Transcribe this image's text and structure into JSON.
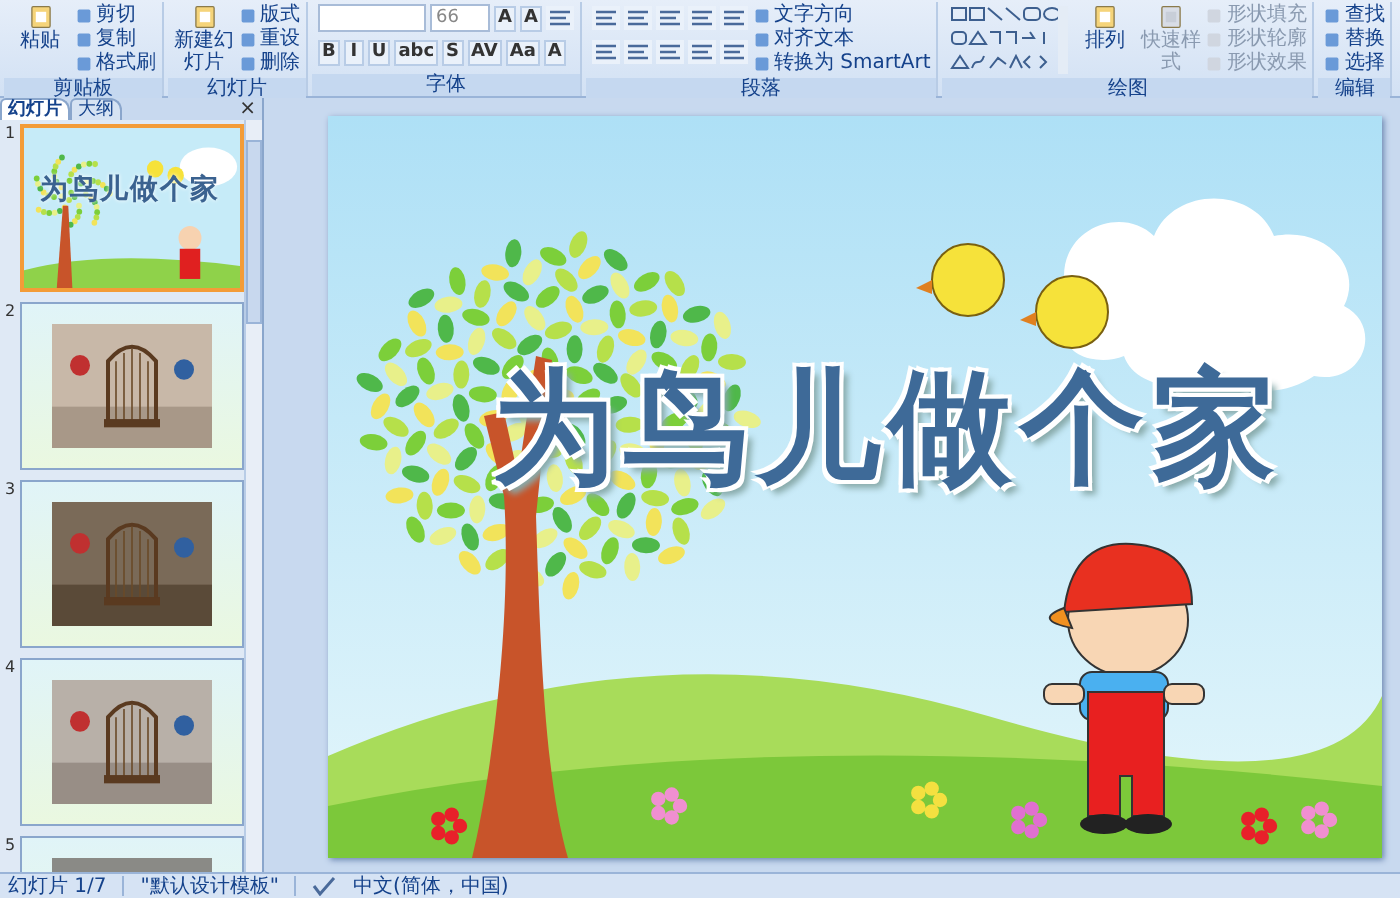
{
  "ribbon": {
    "groups": [
      {
        "label": "剪贴板",
        "items": [
          {
            "kind": "large",
            "label": "粘贴"
          },
          {
            "kind": "small",
            "label": "剪切"
          },
          {
            "kind": "small",
            "label": "复制"
          },
          {
            "kind": "small",
            "label": "格式刷"
          }
        ]
      },
      {
        "label": "幻灯片",
        "items": [
          {
            "kind": "large",
            "label": "新建幻灯片"
          },
          {
            "kind": "small",
            "label": "版式"
          },
          {
            "kind": "small",
            "label": "重设"
          },
          {
            "kind": "small",
            "label": "删除"
          }
        ]
      },
      {
        "label": "字体",
        "rows": [
          {
            "tools": [
              {
                "kind": "field"
              },
              {
                "kind": "field",
                "value": "66"
              },
              {
                "kind": "glyph",
                "label": "A"
              },
              {
                "kind": "glyph",
                "label": "A"
              },
              {
                "kind": "icon"
              }
            ]
          },
          {
            "tools": [
              {
                "kind": "glyph",
                "label": "B"
              },
              {
                "kind": "glyph",
                "label": "I"
              },
              {
                "kind": "glyph",
                "label": "U"
              },
              {
                "kind": "glyph",
                "label": "abc"
              },
              {
                "kind": "glyph",
                "label": "S"
              },
              {
                "kind": "glyph",
                "label": "AV"
              },
              {
                "kind": "glyph",
                "label": "Aa"
              },
              {
                "kind": "glyph",
                "label": "A"
              }
            ]
          }
        ]
      },
      {
        "label": "段落",
        "rows": [
          {
            "tools": [
              {
                "kind": "icon"
              },
              {
                "kind": "icon"
              },
              {
                "kind": "icon"
              },
              {
                "kind": "icon"
              },
              {
                "kind": "icon"
              }
            ]
          },
          {
            "tools": [
              {
                "kind": "icon"
              },
              {
                "kind": "icon"
              },
              {
                "kind": "icon"
              },
              {
                "kind": "icon"
              },
              {
                "kind": "icon"
              }
            ]
          }
        ],
        "items": [
          {
            "kind": "small",
            "label": "文字方向"
          },
          {
            "kind": "small",
            "label": "对齐文本"
          },
          {
            "kind": "small",
            "label": "转换为 SmartArt"
          }
        ]
      },
      {
        "label": "绘图",
        "items": [
          {
            "kind": "gallery",
            "disabled": false
          },
          {
            "kind": "large",
            "label": "排列",
            "disabled": false
          },
          {
            "kind": "large",
            "label": "快速样式",
            "disabled": true
          },
          {
            "kind": "small",
            "label": "形状填充",
            "disabled": true
          },
          {
            "kind": "small",
            "label": "形状轮廓",
            "disabled": true
          },
          {
            "kind": "small",
            "label": "形状效果",
            "disabled": true
          }
        ]
      },
      {
        "label": "编辑",
        "items": [
          {
            "kind": "small",
            "label": "查找"
          },
          {
            "kind": "small",
            "label": "替换"
          },
          {
            "kind": "small",
            "label": "选择"
          }
        ]
      }
    ]
  },
  "panel": {
    "tabs": [
      {
        "label": "幻灯片",
        "selected": true
      },
      {
        "label": "大纲",
        "selected": false
      }
    ],
    "close": "×",
    "slides": [
      {
        "number": "1",
        "selected": true,
        "kind": "title",
        "title": "为鸟儿做个家"
      },
      {
        "number": "2",
        "selected": false,
        "kind": "picture"
      },
      {
        "number": "3",
        "selected": false,
        "kind": "picture"
      },
      {
        "number": "4",
        "selected": false,
        "kind": "picture"
      },
      {
        "number": "5",
        "selected": false,
        "kind": "picture"
      }
    ]
  },
  "slide": {
    "title": "为鸟儿做个家"
  },
  "status_bar": {
    "slide": "幻灯片 1/7",
    "theme": "\"默认设计模板\"",
    "language": "中文(简体，中国)"
  }
}
